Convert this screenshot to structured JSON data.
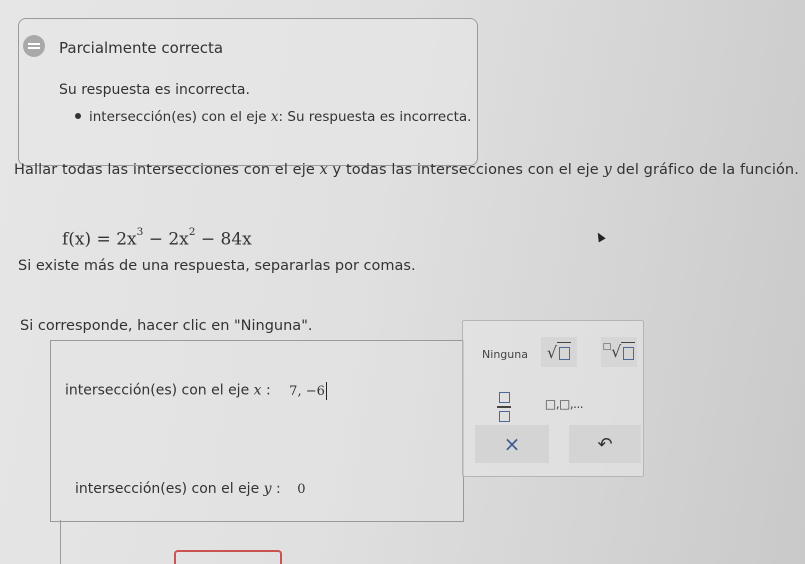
{
  "feedback": {
    "status": "Parcialmente correcta",
    "summary": "Su respuesta es incorrecta.",
    "detail_prefix": "intersección(es) con el eje ",
    "detail_var": "x",
    "detail_suffix": ": Su respuesta es incorrecta.",
    "icon": "feedback-lines-icon"
  },
  "question": {
    "instruction_a": "Hallar todas las intersecciones con el eje ",
    "instruction_x": "x",
    "instruction_b": " y todas las intersecciones con el eje ",
    "instruction_y": "y",
    "instruction_c": " del gráfico de la función.",
    "formula_lhs": "f(x) = 2x",
    "formula_exp1": "3",
    "formula_mid": " − 2x",
    "formula_exp2": "2",
    "formula_rhs": " − 84x",
    "hint_multiple": "Si existe más de una respuesta, separarlas por comas.",
    "hint_none": "Si corresponde, hacer clic en \"Ninguna\"."
  },
  "answers": {
    "x_label": "intersección(es) con el eje ",
    "x_var": "x",
    "x_colon": " :",
    "x_value": "7, −6",
    "y_label": "intersección(es) con el eje ",
    "y_var": "y",
    "y_colon": " :",
    "y_value": "0"
  },
  "palette": {
    "none_label": "Ninguna",
    "sqrt_label": "√",
    "nroot_label": "√",
    "nroot_index": "□",
    "list_label": "□,□,...",
    "clear_label": "×",
    "undo_label": "↶"
  },
  "colors": {
    "accent_blue": "#3b5d8f",
    "tab_red": "#c9544f"
  }
}
